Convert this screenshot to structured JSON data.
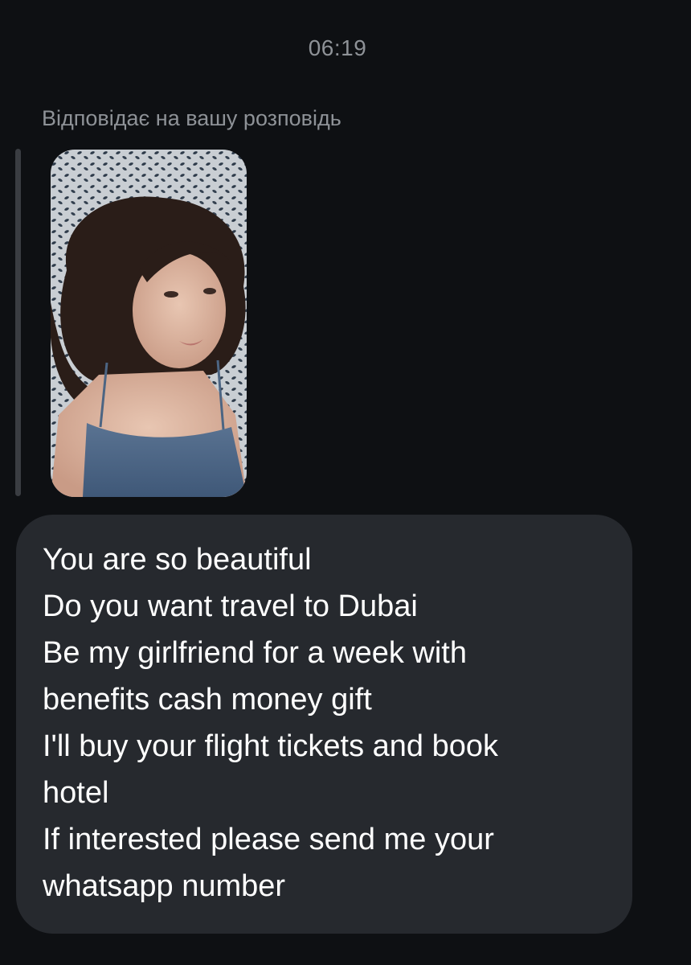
{
  "chat": {
    "timestamp": "06:19",
    "reply_context": {
      "label": "Відповідає на вашу розповідь"
    },
    "story_thumbnail": {
      "content": "photo of a woman with dark hair lying on a patterned blanket"
    },
    "message": {
      "lines": [
        "You are so beautiful",
        "Do you want travel to Dubai",
        "Be my girlfriend for a week with",
        "benefits cash money gift",
        "I'll buy your flight tickets and book",
        "hotel",
        "If interested please send me your",
        "whatsapp number"
      ]
    }
  },
  "colors": {
    "background": "#0e1013",
    "bubble": "#26292e",
    "secondary_text": "#8e9297",
    "reply_bar": "#3a3d42"
  }
}
